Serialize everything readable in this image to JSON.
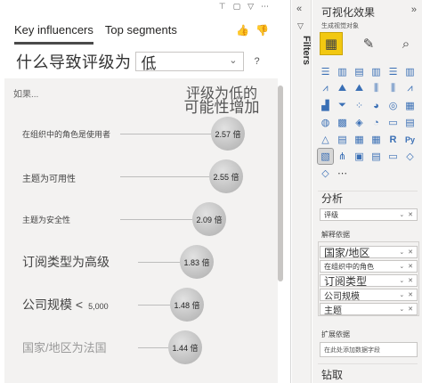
{
  "visual": {
    "header_icons": [
      "pin-icon",
      "copy-icon",
      "filter-icon",
      "more-icon"
    ],
    "tabs": [
      {
        "label": "Key influencers",
        "active": true
      },
      {
        "label": "Top segments",
        "active": false
      }
    ],
    "question": {
      "prefix": "什么导致评级为",
      "value": "低",
      "help": "?"
    },
    "influencer_panel": {
      "when_label": "如果...",
      "likely_line1": "评级为低的",
      "likely_line2": "可能性增加",
      "rows": [
        {
          "label": "在组织中的角色是使用者",
          "multiplier": "2.57 倍",
          "value": 2.57
        },
        {
          "label": "主题为可用性",
          "multiplier": "2.55 倍",
          "value": 2.55
        },
        {
          "label": "主题为安全性",
          "multiplier": "2.09 倍",
          "value": 2.09
        },
        {
          "label": "订阅类型为高级",
          "multiplier": "1.83 倍",
          "value": 1.83
        },
        {
          "label": "公司规模 <",
          "label_suffix": "5,000",
          "multiplier": "1.48 倍",
          "value": 1.48
        },
        {
          "label": "国家/地区为法国",
          "multiplier": "1.44 倍",
          "value": 1.44
        }
      ]
    }
  },
  "filters_pane": {
    "label": "Filters",
    "collapse_icon": "double-chevron-left-icon"
  },
  "visualizations_pane": {
    "title": "可视化效果",
    "subtitle": "生成视觉对象",
    "collapse_icon": "double-chevron-right-icon",
    "build_icons": [
      "build-visual-icon",
      "format-icon",
      "analytics-icon"
    ],
    "visual_icons": [
      "stacked-bar-icon",
      "stacked-column-icon",
      "clustered-bar-icon",
      "clustered-column-icon",
      "100-bar-icon",
      "100-column-icon",
      "line-chart-icon",
      "area-chart-icon",
      "stacked-area-icon",
      "line-column-icon",
      "line-clustered-icon",
      "ribbon-icon",
      "waterfall-icon",
      "funnel-icon",
      "scatter-icon",
      "pie-icon",
      "donut-icon",
      "treemap-icon",
      "map-icon",
      "filled-map-icon",
      "shape-map-icon",
      "gauge-icon",
      "card-icon",
      "multirow-card-icon",
      "kpi-icon",
      "slicer-icon",
      "table-icon",
      "matrix-icon",
      "r-visual-icon",
      "python-visual-icon",
      "key-influencers-icon",
      "decomposition-tree-icon",
      "qa-icon",
      "smart-narrative-icon",
      "paginated-icon",
      "power-apps-icon",
      "power-automate-icon",
      "get-more-icon"
    ],
    "analyze_title": "分析",
    "analyze_field": "评级",
    "explain_by_title": "解释依据",
    "explain_by_fields": [
      {
        "label": "国家/地区",
        "size": "big"
      },
      {
        "label": "在组织中的角色",
        "size": "small"
      },
      {
        "label": "订阅类型",
        "size": "big"
      },
      {
        "label": "公司规模",
        "size": "mid"
      },
      {
        "label": "主题",
        "size": "mid"
      }
    ],
    "expand_by_title": "扩展依据",
    "expand_by_placeholder": "在此处添加数据字段",
    "drillthrough_title": "钻取"
  }
}
